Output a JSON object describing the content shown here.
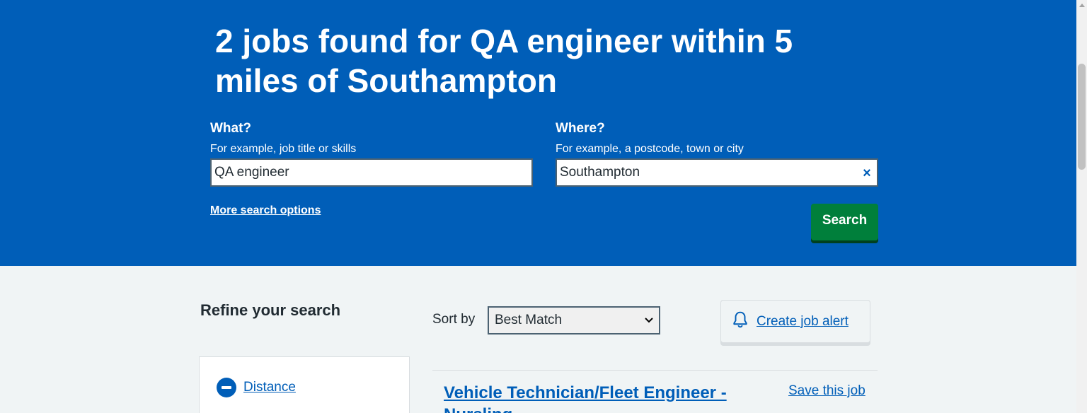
{
  "hero": {
    "heading": "2 jobs found for QA engineer within 5 miles of Southampton"
  },
  "search": {
    "what_label": "What?",
    "what_hint": "For example, job title or skills",
    "what_value": "QA engineer",
    "where_label": "Where?",
    "where_hint": "For example, a postcode, town or city",
    "where_value": "Southampton",
    "clear_icon": "×",
    "more_options": "More search options",
    "submit_label": "Search"
  },
  "refine": {
    "title": "Refine your search",
    "filters": [
      {
        "label": "Distance",
        "icon": "minus-circle-icon"
      }
    ]
  },
  "sort": {
    "label": "Sort by",
    "selected": "Best Match"
  },
  "alert": {
    "icon": "bell-icon",
    "label": "Create job alert"
  },
  "results": [
    {
      "title": "Vehicle Technician/Fleet Engineer - Nursling",
      "save_label": "Save this job"
    }
  ],
  "colors": {
    "brand_blue": "#005eb8",
    "button_green": "#007f3b",
    "page_bg": "#f0f4f5"
  }
}
